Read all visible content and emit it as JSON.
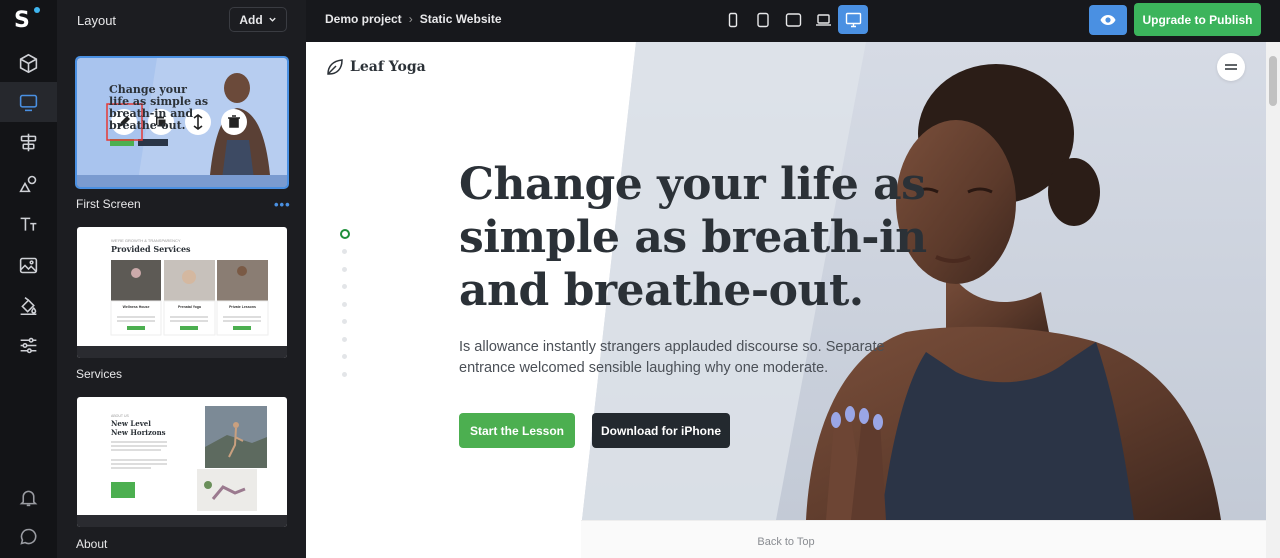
{
  "sidebar": {
    "title": "Layout",
    "add_label": "Add",
    "sections": [
      {
        "label": "First Screen"
      },
      {
        "label": "Services"
      },
      {
        "label": "About"
      }
    ],
    "more_label": "•••"
  },
  "thumb1": {
    "headline": "Change your life as simple as breath-in and breathe-out."
  },
  "thumb2": {
    "kicker": "WE'RE GROWTH & TRANSPARENCY",
    "title": "Provided Services",
    "cards": [
      "Wellness House",
      "Prenatal Yoga",
      "Private Lessons"
    ]
  },
  "thumb3": {
    "kicker": "ABOUT US",
    "title": "New Level\nNew Horizons"
  },
  "topbar": {
    "project": "Demo project",
    "separator": "›",
    "page": "Static Website",
    "publish_label": "Upgrade to Publish",
    "devices": [
      "phone-portrait-icon",
      "phone-landscape-icon",
      "tablet-icon",
      "laptop-icon",
      "desktop-icon"
    ],
    "active_device": "desktop-icon"
  },
  "site": {
    "brand": "Leaf Yoga",
    "headline": "Change your life as simple as breath-in and breathe-out.",
    "sub": "Is allowance instantly strangers applauded discourse so. Separate entrance welcomed sensible laughing why one moderate.",
    "cta_primary": "Start the Lesson",
    "cta_secondary": "Download for iPhone",
    "back_to_top": "Back to Top",
    "pager_count": 9,
    "pager_active": 0
  },
  "colors": {
    "accent_blue": "#4a90e2",
    "publish_green": "#3cb45c",
    "cta_green": "#4caf50",
    "dark": "#23292f"
  }
}
